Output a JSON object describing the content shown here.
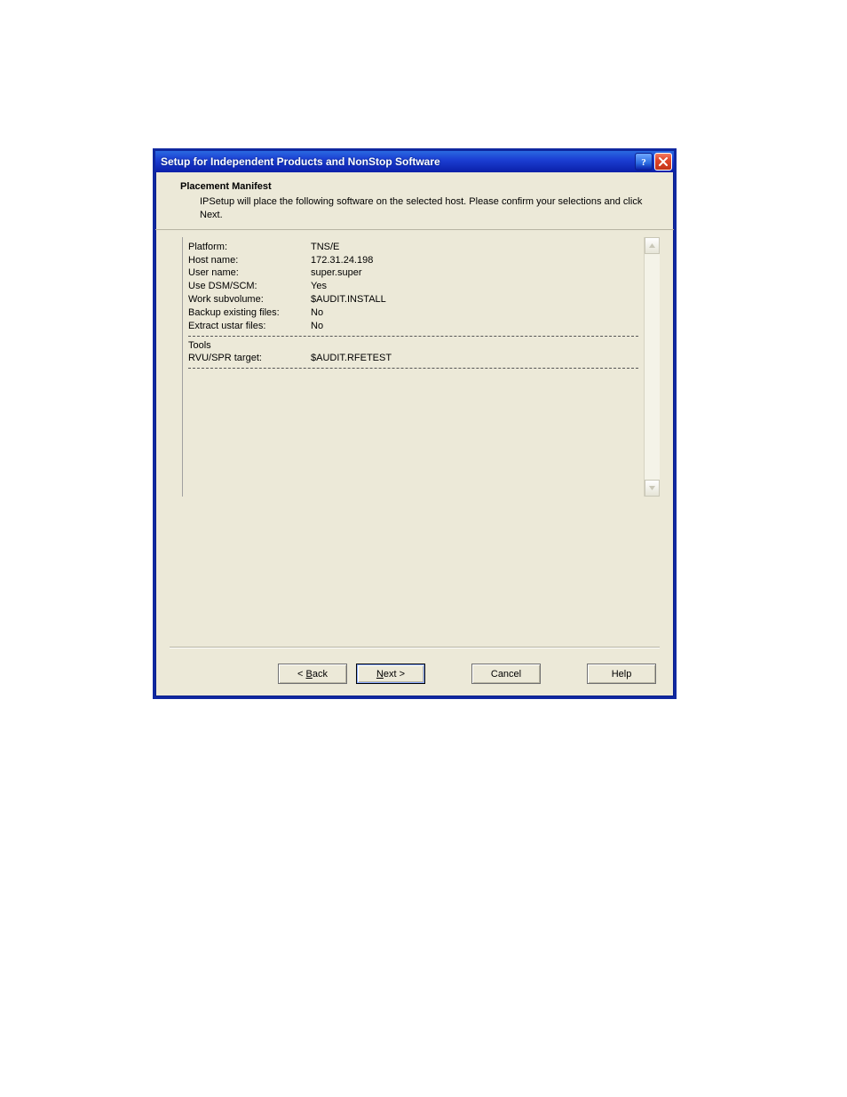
{
  "window": {
    "title": "Setup for Independent Products and NonStop Software"
  },
  "header": {
    "title": "Placement Manifest",
    "description": "IPSetup will place the following software on the selected host. Please confirm your selections and click Next."
  },
  "manifest": {
    "rows": [
      {
        "label": "Platform:",
        "value": "TNS/E"
      },
      {
        "label": "Host name:",
        "value": "172.31.24.198"
      },
      {
        "label": "User name:",
        "value": "super.super"
      },
      {
        "label": "Use DSM/SCM:",
        "value": "Yes"
      },
      {
        "label": "Work subvolume:",
        "value": "$AUDIT.INSTALL"
      },
      {
        "label": "Backup existing files:",
        "value": "No"
      },
      {
        "label": "Extract ustar files:",
        "value": "No"
      }
    ],
    "section2_title": "Tools",
    "section2_rows": [
      {
        "label": "RVU/SPR target:",
        "value": "$AUDIT.RFETEST"
      }
    ]
  },
  "buttons": {
    "back_prefix": "< ",
    "back_mnemonic": "B",
    "back_rest": "ack",
    "next_mnemonic": "N",
    "next_rest": "ext >",
    "cancel": "Cancel",
    "help": "Help"
  },
  "titlebar_icons": {
    "help": "?",
    "close": "X"
  }
}
